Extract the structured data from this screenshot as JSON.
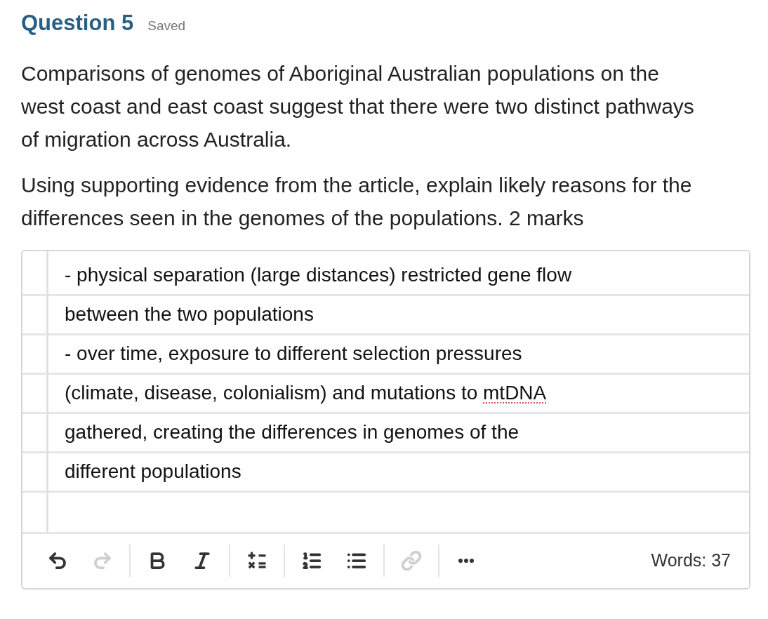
{
  "header": {
    "title": "Question 5",
    "status": "Saved"
  },
  "prompt": [
    "Comparisons of genomes of Aboriginal Australian populations on the west coast and east coast suggest that there were two distinct pathways of migration across Australia.",
    "Using supporting evidence from the article, explain likely reasons for the differences seen in the genomes of the populations. 2 marks"
  ],
  "answer": {
    "lines": [
      {
        "segments": [
          {
            "text": "- physical separation (large distances) restricted gene flow",
            "misspelled": false
          }
        ]
      },
      {
        "segments": [
          {
            "text": "between the two populations",
            "misspelled": false
          }
        ]
      },
      {
        "segments": [
          {
            "text": "- over time, exposure to different selection pressures",
            "misspelled": false
          }
        ]
      },
      {
        "segments": [
          {
            "text": "(climate, disease, colonialism) and mutations to ",
            "misspelled": false
          },
          {
            "text": "mtDNA",
            "misspelled": true
          }
        ]
      },
      {
        "segments": [
          {
            "text": "gathered, creating the differences in genomes of the",
            "misspelled": false
          }
        ]
      },
      {
        "segments": [
          {
            "text": "different populations",
            "misspelled": false
          }
        ]
      }
    ]
  },
  "toolbar": {
    "groups": [
      [
        {
          "kind": "undo",
          "disabled": false
        },
        {
          "kind": "redo",
          "disabled": true
        }
      ],
      [
        {
          "kind": "bold",
          "disabled": false
        },
        {
          "kind": "italic",
          "disabled": false
        }
      ],
      [
        {
          "kind": "formula",
          "disabled": false
        }
      ],
      [
        {
          "kind": "ordered_list",
          "disabled": false
        },
        {
          "kind": "bullet_list",
          "disabled": false
        }
      ],
      [
        {
          "kind": "link",
          "disabled": true
        }
      ],
      [
        {
          "kind": "more",
          "disabled": false
        }
      ]
    ],
    "word_count": "Words: 37"
  }
}
